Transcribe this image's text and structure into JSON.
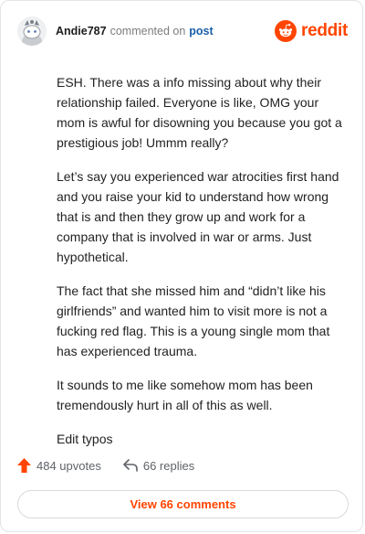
{
  "header": {
    "username": "Andie787",
    "commented_text": "commented on",
    "post_link": "post",
    "brand": "reddit"
  },
  "comment": {
    "paragraphs": [
      "ESH. There was a info missing about why their relationship failed. Everyone is like, OMG your mom is awful for disowning you because you got a prestigious job! Ummm really?",
      "Let’s say you experienced war atrocities first hand and you raise your kid to understand how wrong that is and then they grow up and work for a company that is involved in war or arms. Just hypothetical.",
      "The fact that she missed him and “didn’t like his girlfriends” and wanted him to visit more is not a fucking red flag. This is a young single mom that has experienced trauma.",
      "It sounds to me like somehow mom has been tremendously hurt in all of this as well.",
      "Edit typos"
    ]
  },
  "actions": {
    "upvotes": "484 upvotes",
    "replies": "66 replies",
    "view_comments": "View 66 comments"
  },
  "colors": {
    "brand": "#ff4500",
    "link": "#1a5fa8",
    "muted": "#7c7c7c"
  },
  "icons": [
    "avatar",
    "reddit-logo-icon",
    "upvote-arrow-icon",
    "reply-arrow-icon"
  ]
}
